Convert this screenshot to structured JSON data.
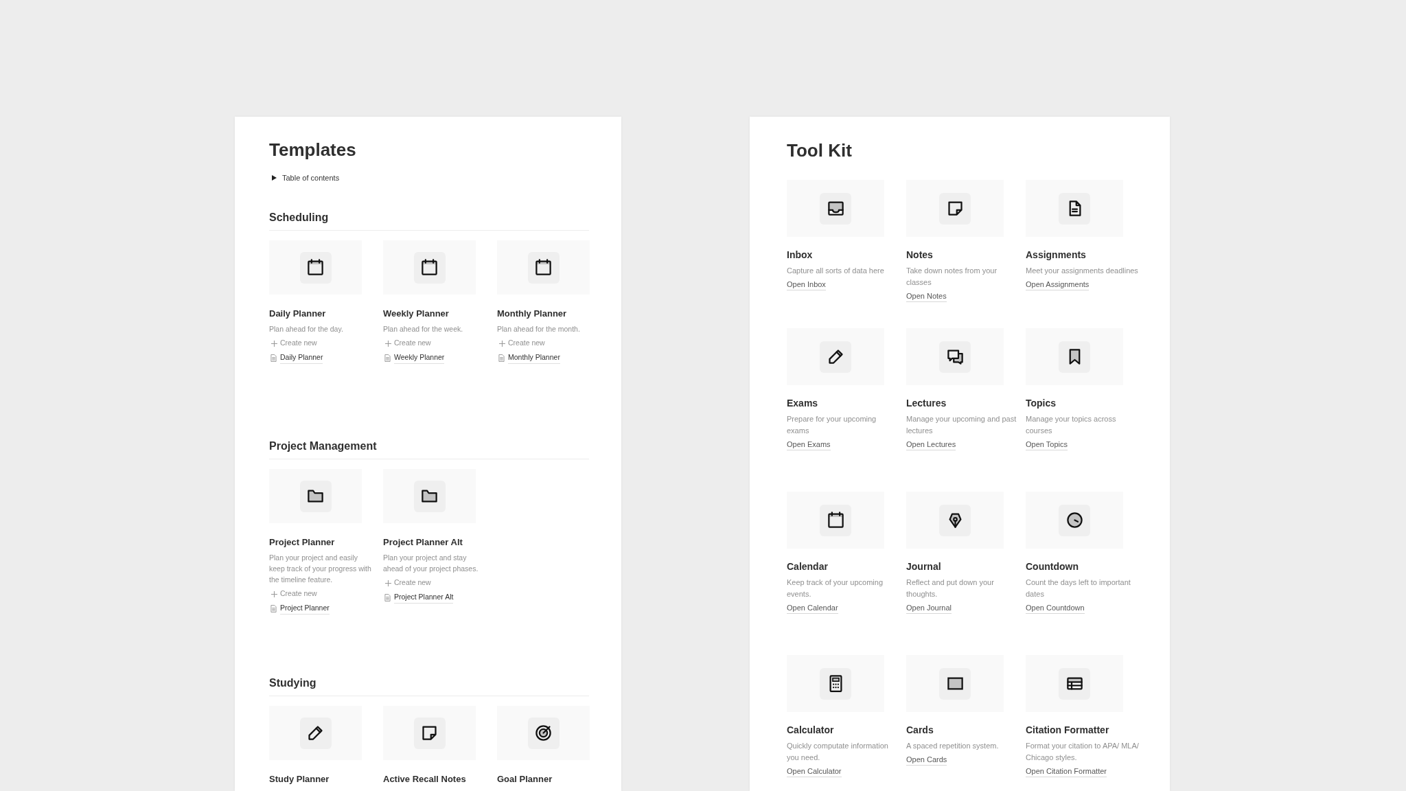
{
  "templates": {
    "title": "Templates",
    "toc": {
      "label": "Table of contents",
      "expanded": false
    },
    "sections": [
      {
        "heading": "Scheduling",
        "items": [
          {
            "kind": "calendar",
            "title": "Daily Planner",
            "description": "Plan ahead for the day.",
            "create_label": "Create new",
            "page": "Daily Planner"
          },
          {
            "kind": "calendar",
            "title": "Weekly Planner",
            "description": "Plan ahead for the week.",
            "create_label": "Create new",
            "page": "Weekly Planner"
          },
          {
            "kind": "calendar",
            "title": "Monthly Planner",
            "description": "Plan ahead for the month.",
            "create_label": "Create new",
            "page": "Monthly Planner"
          }
        ]
      },
      {
        "heading": "Project Management",
        "items": [
          {
            "kind": "folder",
            "title": "Project Planner",
            "description": "Plan your project and easily keep track of your progress with the timeline feature.",
            "create_label": "Create new",
            "page": "Project Planner"
          },
          {
            "kind": "folder",
            "title": "Project Planner Alt",
            "description": "Plan your project and stay ahead of your project phases.",
            "create_label": "Create new",
            "page": "Project Planner Alt"
          }
        ]
      },
      {
        "heading": "Studying",
        "items": [
          {
            "kind": "pencil",
            "title": "Study Planner"
          },
          {
            "kind": "note",
            "title": "Active Recall Notes"
          },
          {
            "kind": "target",
            "title": "Goal Planner"
          }
        ]
      }
    ]
  },
  "tool_kit": {
    "title": "Tool Kit",
    "rows": [
      [
        {
          "kind": "inbox",
          "title": "Inbox",
          "description": "Capture all sorts of data here",
          "link": "Open Inbox"
        },
        {
          "kind": "note",
          "title": "Notes",
          "description": "Take down notes from your classes",
          "link": "Open Notes"
        },
        {
          "kind": "document",
          "title": "Assignments",
          "description": "Meet your assignments deadlines",
          "link": "Open Assignments"
        }
      ],
      [
        {
          "kind": "pencil",
          "title": "Exams",
          "description": "Prepare for your upcoming exams",
          "link": "Open Exams"
        },
        {
          "kind": "chat",
          "title": "Lectures",
          "description": "Manage your upcoming and past lectures",
          "link": "Open Lectures"
        },
        {
          "kind": "bookmark",
          "title": "Topics",
          "description": "Manage your topics across courses",
          "link": "Open Topics"
        }
      ],
      [
        {
          "kind": "calendar",
          "title": "Calendar",
          "description": "Keep track of your upcoming events.",
          "link": "Open Calendar"
        },
        {
          "kind": "pen",
          "title": "Journal",
          "description": "Reflect and put down your thoughts.",
          "link": "Open Journal"
        },
        {
          "kind": "clock",
          "title": "Countdown",
          "description": "Count the days left to important dates",
          "link": "Open Countdown"
        }
      ],
      [
        {
          "kind": "calculator",
          "title": "Calculator",
          "description": "Quickly computate information you need.",
          "link": "Open Calculator"
        },
        {
          "kind": "card",
          "title": "Cards",
          "description": "A spaced repetition system.",
          "link": "Open Cards"
        },
        {
          "kind": "table",
          "title": "Citation Formatter",
          "description": "Format your citation to APA/ MLA/ Chicago styles.",
          "link": "Open Citation Formatter"
        }
      ]
    ]
  }
}
